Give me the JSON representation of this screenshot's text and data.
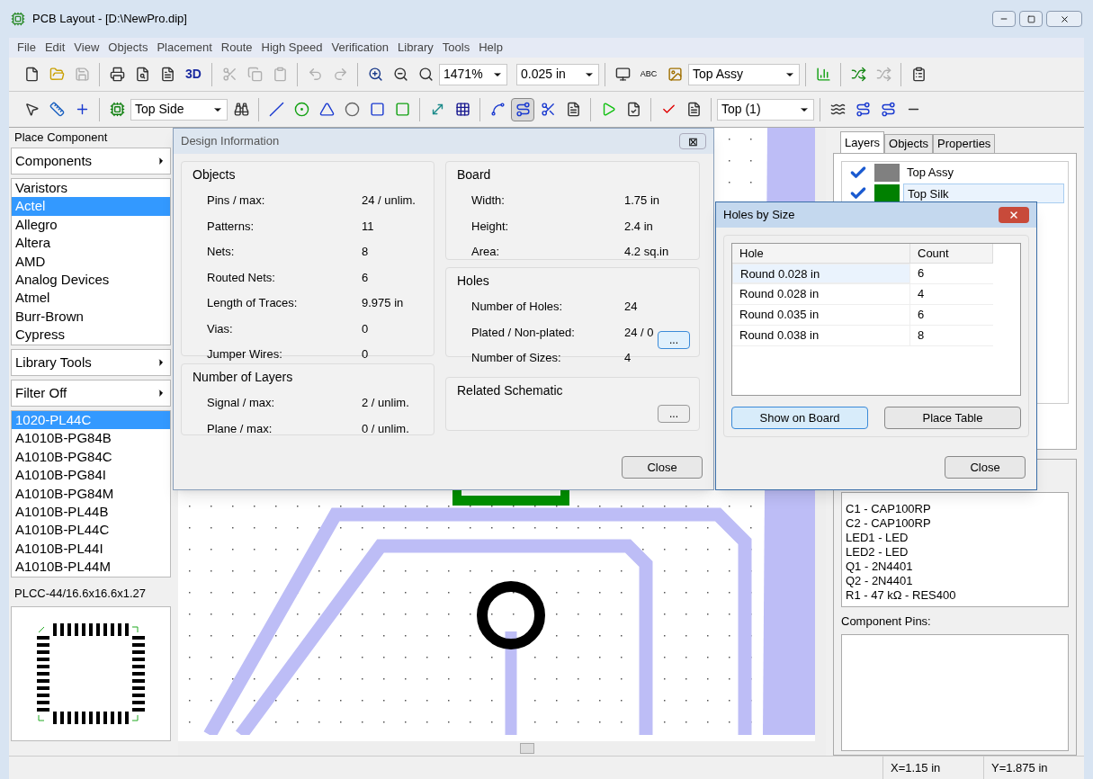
{
  "window": {
    "title": "PCB Layout - [D:\\NewPro.dip]"
  },
  "menu": [
    "File",
    "Edit",
    "View",
    "Objects",
    "Placement",
    "Route",
    "High Speed",
    "Verification",
    "Library",
    "Tools",
    "Help"
  ],
  "toolbar1": {
    "label_3d": "3D",
    "zoom": "1471%",
    "grid": "0.025 in",
    "text_icon": "ABC",
    "layer": "Top Assy"
  },
  "toolbar2": {
    "side": "Top Side",
    "route_layer": "Top (1)"
  },
  "left_panel": {
    "title": "Place Component",
    "components_header": "Components",
    "libraries": [
      {
        "name": "Varistors",
        "selected": false
      },
      {
        "name": "Actel",
        "selected": true
      },
      {
        "name": "Allegro",
        "selected": false
      },
      {
        "name": "Altera",
        "selected": false
      },
      {
        "name": "AMD",
        "selected": false
      },
      {
        "name": "Analog Devices",
        "selected": false
      },
      {
        "name": "Atmel",
        "selected": false
      },
      {
        "name": "Burr-Brown",
        "selected": false
      },
      {
        "name": "Cypress",
        "selected": false
      }
    ],
    "library_tools": "Library Tools",
    "filter": "Filter Off",
    "components": [
      {
        "name": "1020-PL44C",
        "selected": true
      },
      {
        "name": "A1010B-PG84B",
        "selected": false
      },
      {
        "name": "A1010B-PG84C",
        "selected": false
      },
      {
        "name": "A1010B-PG84I",
        "selected": false
      },
      {
        "name": "A1010B-PG84M",
        "selected": false
      },
      {
        "name": "A1010B-PL44B",
        "selected": false
      },
      {
        "name": "A1010B-PL44C",
        "selected": false
      },
      {
        "name": "A1010B-PL44I",
        "selected": false
      },
      {
        "name": "A1010B-PL44M",
        "selected": false
      }
    ],
    "pattern": "PLCC-44/16.6x16.6x1.27"
  },
  "design_info": {
    "title": "Design Information",
    "close_icon": "⊠",
    "objects": {
      "title": "Objects",
      "rows": [
        {
          "label": "Pins / max:",
          "value": "24 / unlim."
        },
        {
          "label": "Patterns:",
          "value": "11"
        },
        {
          "label": "Nets:",
          "value": "8"
        },
        {
          "label": "Routed Nets:",
          "value": "6"
        },
        {
          "label": "Length of Traces:",
          "value": "9.975 in"
        },
        {
          "label": "Vias:",
          "value": "0"
        },
        {
          "label": "Jumper Wires:",
          "value": "0"
        }
      ]
    },
    "layers": {
      "title": "Number of Layers",
      "rows": [
        {
          "label": "Signal / max:",
          "value": "2 / unlim."
        },
        {
          "label": "Plane / max:",
          "value": "0 / unlim."
        }
      ]
    },
    "board": {
      "title": "Board",
      "rows": [
        {
          "label": "Width:",
          "value": "1.75 in"
        },
        {
          "label": "Height:",
          "value": "2.4 in"
        },
        {
          "label": "Area:",
          "value": "4.2 sq.in"
        }
      ]
    },
    "holes": {
      "title": "Holes",
      "rows": [
        {
          "label": "Number of Holes:",
          "value": "24"
        },
        {
          "label": "Plated / Non-plated:",
          "value": "24 / 0"
        },
        {
          "label": "Number of Sizes:",
          "value": "4"
        }
      ],
      "button": "..."
    },
    "schematic": {
      "title": "Related Schematic",
      "button": "..."
    },
    "close": "Close"
  },
  "holes_dialog": {
    "title": "Holes by Size",
    "columns": [
      "Hole",
      "Count"
    ],
    "rows": [
      {
        "hole": "Round 0.028 in",
        "count": "6",
        "selected": true
      },
      {
        "hole": "Round 0.028 in",
        "count": "4",
        "selected": false
      },
      {
        "hole": "Round 0.035 in",
        "count": "6",
        "selected": false
      },
      {
        "hole": "Round 0.038 in",
        "count": "8",
        "selected": false
      }
    ],
    "show_button": "Show on Board",
    "place_button": "Place Table",
    "close": "Close"
  },
  "right_panel": {
    "tabs": [
      {
        "label": "Layers",
        "selected": true
      },
      {
        "label": "Objects",
        "selected": false
      },
      {
        "label": "Properties",
        "selected": false
      }
    ],
    "layers": [
      {
        "name": "Top Assy",
        "checked": true,
        "color": "#808080",
        "selected": false
      },
      {
        "name": "Top Silk",
        "checked": true,
        "color": "#008000",
        "selected": true
      }
    ],
    "components": [
      "C1 - CAP100RP",
      "C2 - CAP100RP",
      "LED1 - LED",
      "LED2 - LED",
      "Q1 - 2N4401",
      "Q2 - 2N4401",
      "R1 - 47 kΩ - RES400"
    ],
    "pins_label": "Component Pins:"
  },
  "status_bar": {
    "x": "X=1.15 in",
    "y": "Y=1.875 in"
  }
}
